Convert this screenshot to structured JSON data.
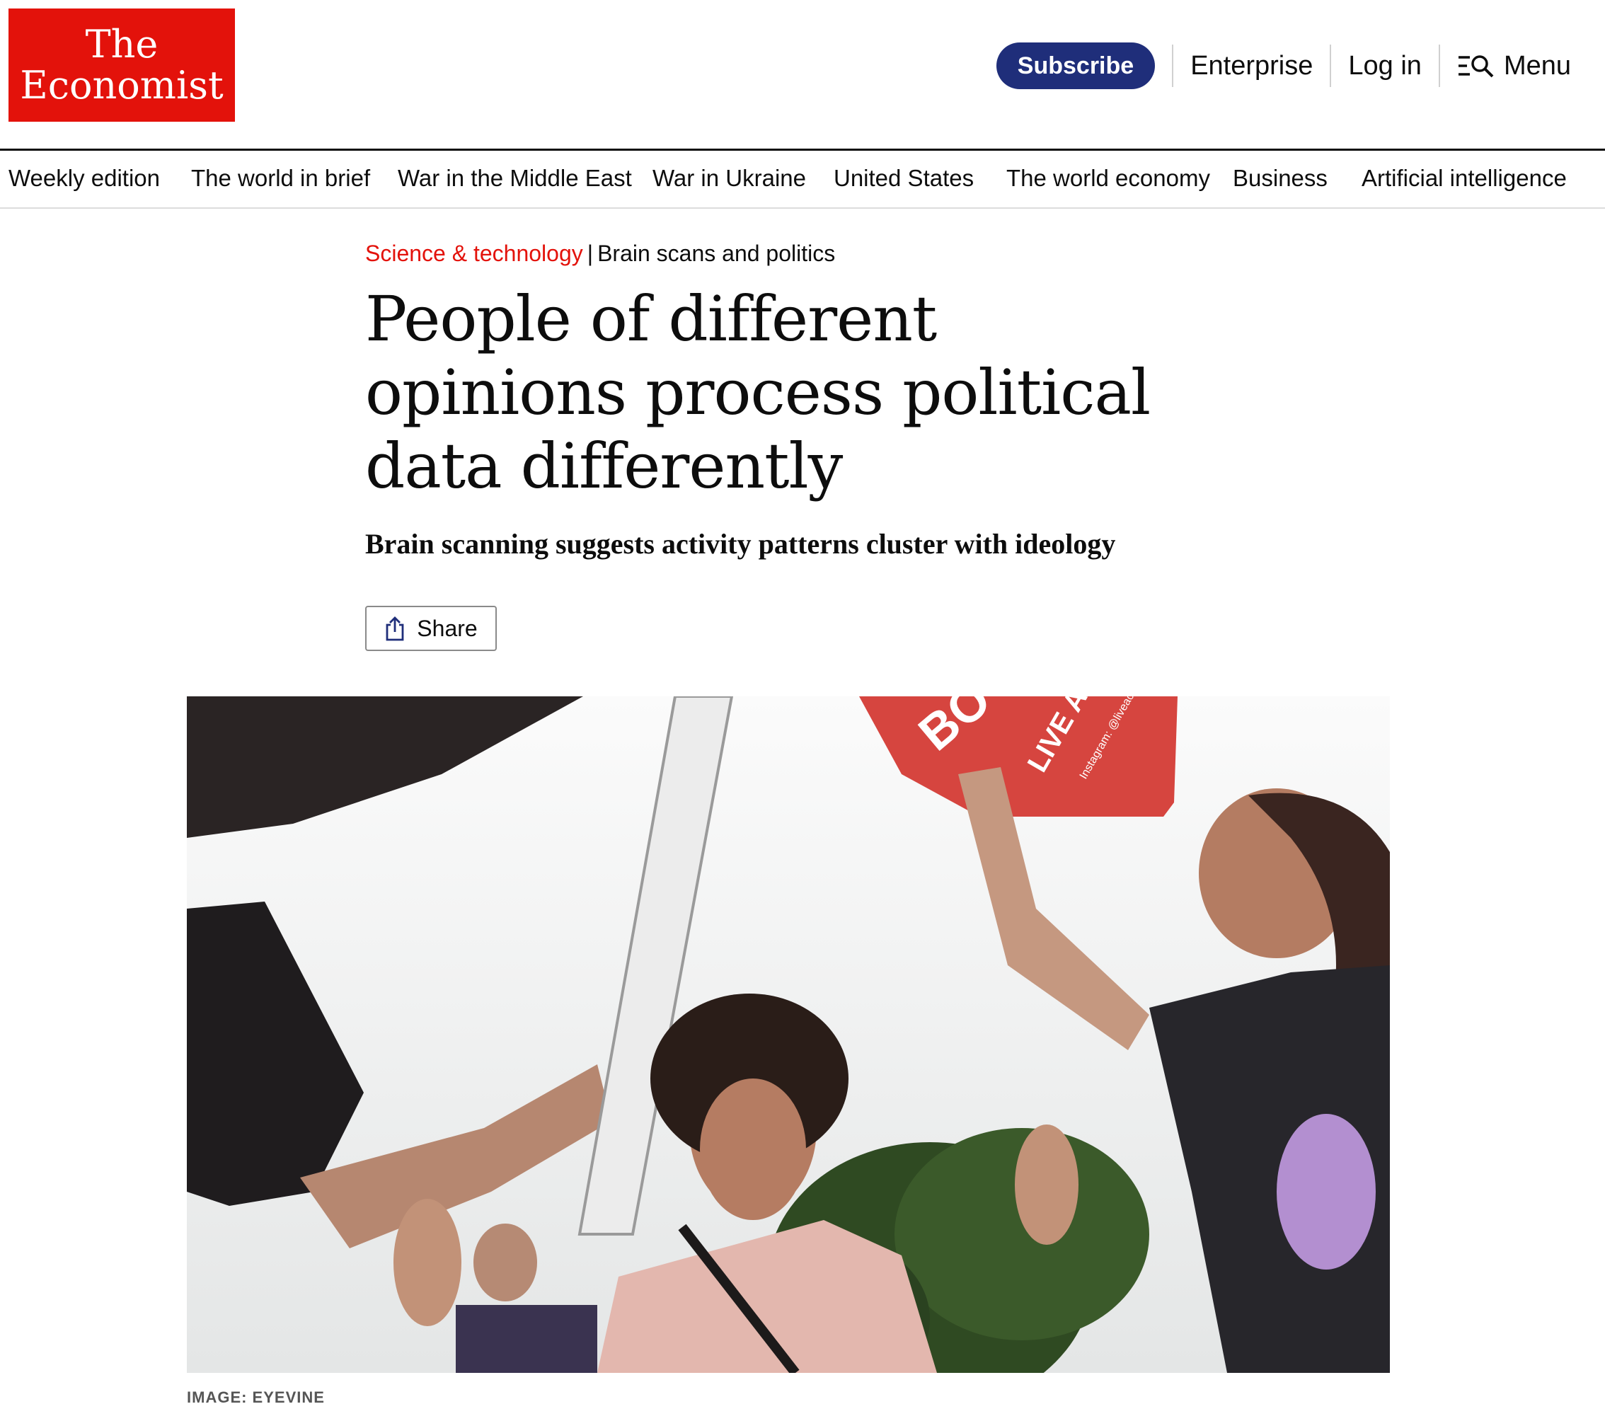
{
  "brand": {
    "line1": "The",
    "line2": "Economist",
    "color": "#e3120b"
  },
  "top_actions": {
    "subscribe": "Subscribe",
    "enterprise": "Enterprise",
    "login": "Log in",
    "menu": "Menu",
    "subscribe_color": "#1f2e7a"
  },
  "nav": [
    "Weekly edition",
    "The world in brief",
    "War in the Middle East",
    "War in Ukraine",
    "United States",
    "The world economy",
    "Business",
    "Artificial intelligence"
  ],
  "article": {
    "section": "Science & technology",
    "fly_title": "Brain scans and politics",
    "headline": "People of different opinions process political data differently",
    "subheadline": "Brain scanning suggests activity patterns cluster with ideology",
    "share": "Share",
    "image_credit": "IMAGE: EYEVINE",
    "image_sign_text": "LIVE ACTION",
    "image_sign_handle": "Instagram: @liveaction",
    "image_sign_letters": "BO"
  },
  "icons": {
    "menu": "menu-search-icon",
    "share": "share-icon"
  }
}
